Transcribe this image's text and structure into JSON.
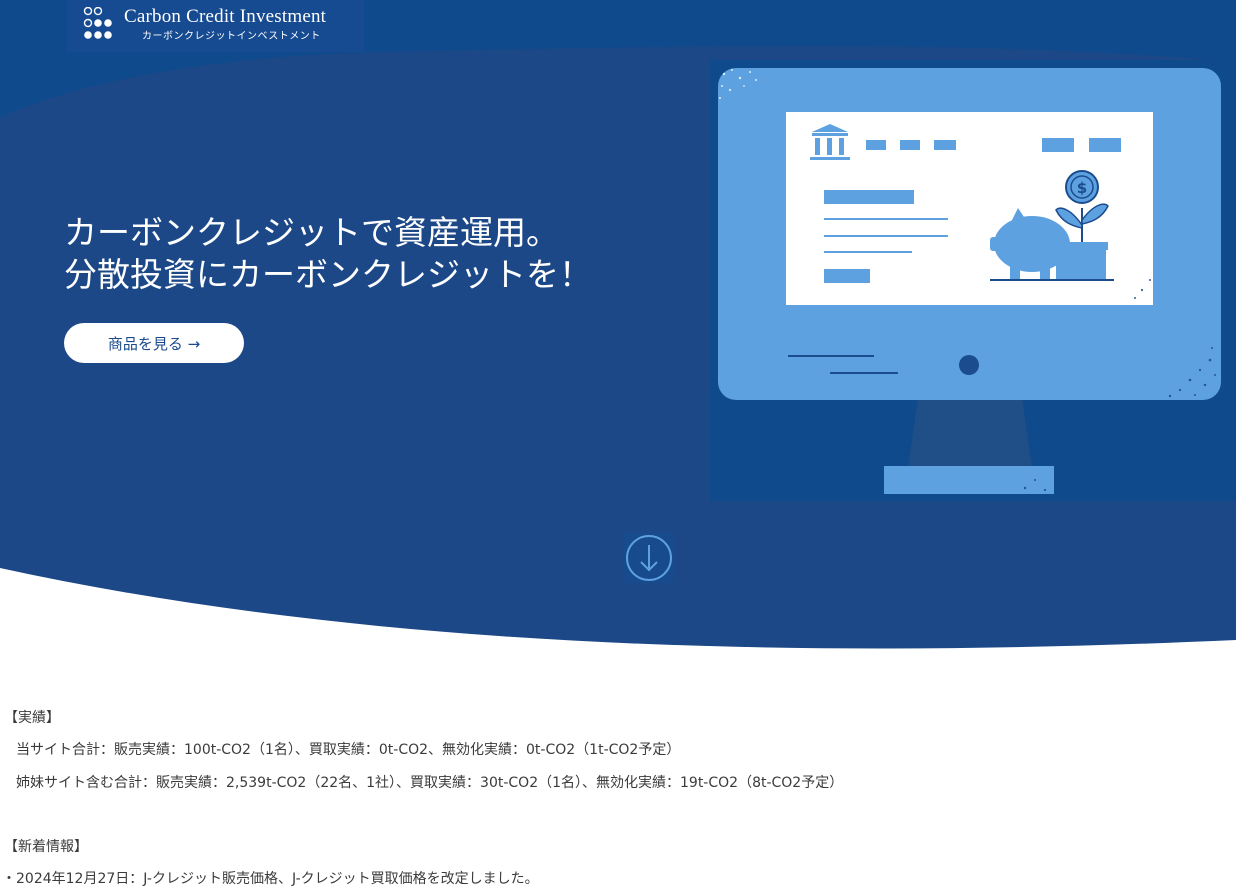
{
  "brand": {
    "title": "Carbon Credit Investment",
    "subtitle": "カーボンクレジットインベストメント"
  },
  "hero": {
    "heading_line1": "カーボンクレジットで資産運用。",
    "heading_line2": "分散投資にカーボンクレジットを！",
    "cta_label": "商品を見る →",
    "scroll_icon": "arrow-down-circle-icon"
  },
  "colors": {
    "hero_blue": "#1c4888",
    "header_blue": "#0e4a8c",
    "monitor_blue": "#5ea1e0",
    "screen_white": "#ffffff",
    "dark_navy": "#1b4d8e"
  },
  "results": {
    "heading": "【実績】",
    "line_site": "当サイト合計：販売実績：100t-CO2（1名）、買取実績：0t-CO2、無効化実績：0t-CO2（1t-CO2予定）",
    "line_sister": "姉妹サイト含む合計：販売実績：2,539t-CO2（22名、1社）、買取実績：30t-CO2（1名）、無効化実績：19t-CO2（8t-CO2予定）"
  },
  "news": {
    "heading": "【新着情報】",
    "items": [
      "・2024年12月27日：J-クレジット販売価格、J-クレジット買取価格を改定しました。"
    ]
  }
}
